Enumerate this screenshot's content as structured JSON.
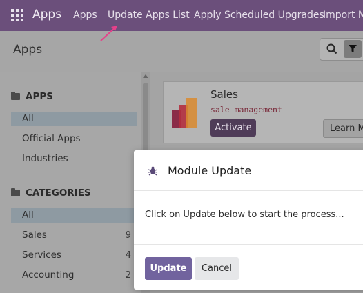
{
  "navbar": {
    "app_name": "Apps",
    "menu": [
      "Apps",
      "Update Apps List",
      "Apply Scheduled Upgrades",
      "Import Module"
    ]
  },
  "control_panel": {
    "title": "Apps"
  },
  "sidebar": {
    "apps_header": "APPS",
    "apps_items": [
      "All",
      "Official Apps",
      "Industries"
    ],
    "categories_header": "CATEGORIES",
    "categories": [
      {
        "label": "All",
        "count": ""
      },
      {
        "label": "Sales",
        "count": "9"
      },
      {
        "label": "Services",
        "count": "4"
      },
      {
        "label": "Accounting",
        "count": "2"
      }
    ]
  },
  "app_card": {
    "name": "Sales",
    "technical_name": "sale_management",
    "activate_label": "Activate",
    "learn_label": "Learn More"
  },
  "modal": {
    "title": "Module Update",
    "body": "Click on Update below to start the process...",
    "update_label": "Update",
    "cancel_label": "Cancel"
  },
  "colors": {
    "navbar": "#6b4f7b",
    "primary_button": "#71639e",
    "annotation_arrow": "#e6408a"
  },
  "icons": [
    "apps-grid-icon",
    "search-icon",
    "filter-icon",
    "folder-icon",
    "bug-icon",
    "sales-app-icon"
  ]
}
